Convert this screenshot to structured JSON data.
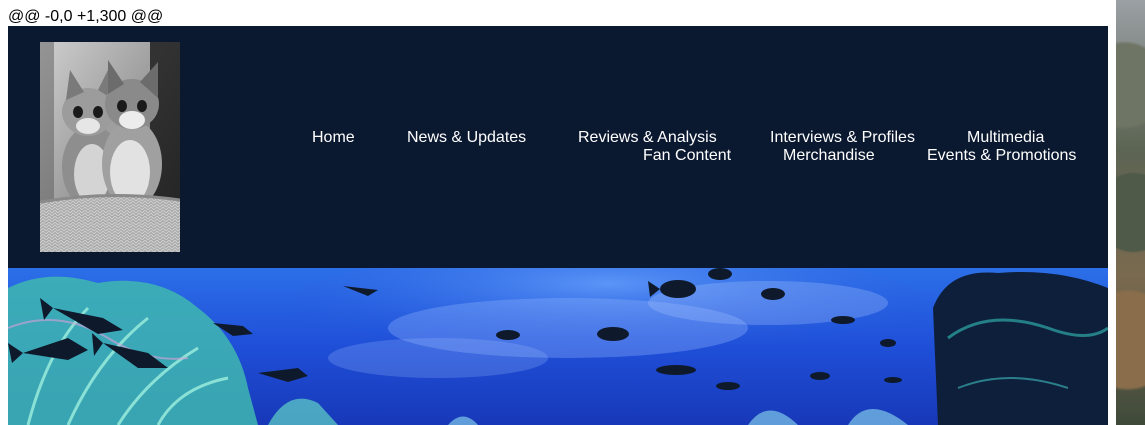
{
  "diff_header": "@@ -0,0 +1,300 @@",
  "nav": {
    "items": [
      {
        "label": "Home"
      },
      {
        "label": "News & Updates"
      },
      {
        "label": "Reviews & Analysis"
      },
      {
        "label": "Interviews & Profiles"
      },
      {
        "label": "Multimedia"
      },
      {
        "label": "Fan Content"
      },
      {
        "label": "Merchandise"
      },
      {
        "label": "Events & Promotions"
      }
    ]
  },
  "colors": {
    "header_background": "#0b1930",
    "nav_text": "#ffffff",
    "banner_water": "#1f4fd8",
    "coral": "#5fd3c4"
  },
  "images": {
    "logo": "kittens-photo",
    "banner": "underwater-reef-with-fish"
  }
}
